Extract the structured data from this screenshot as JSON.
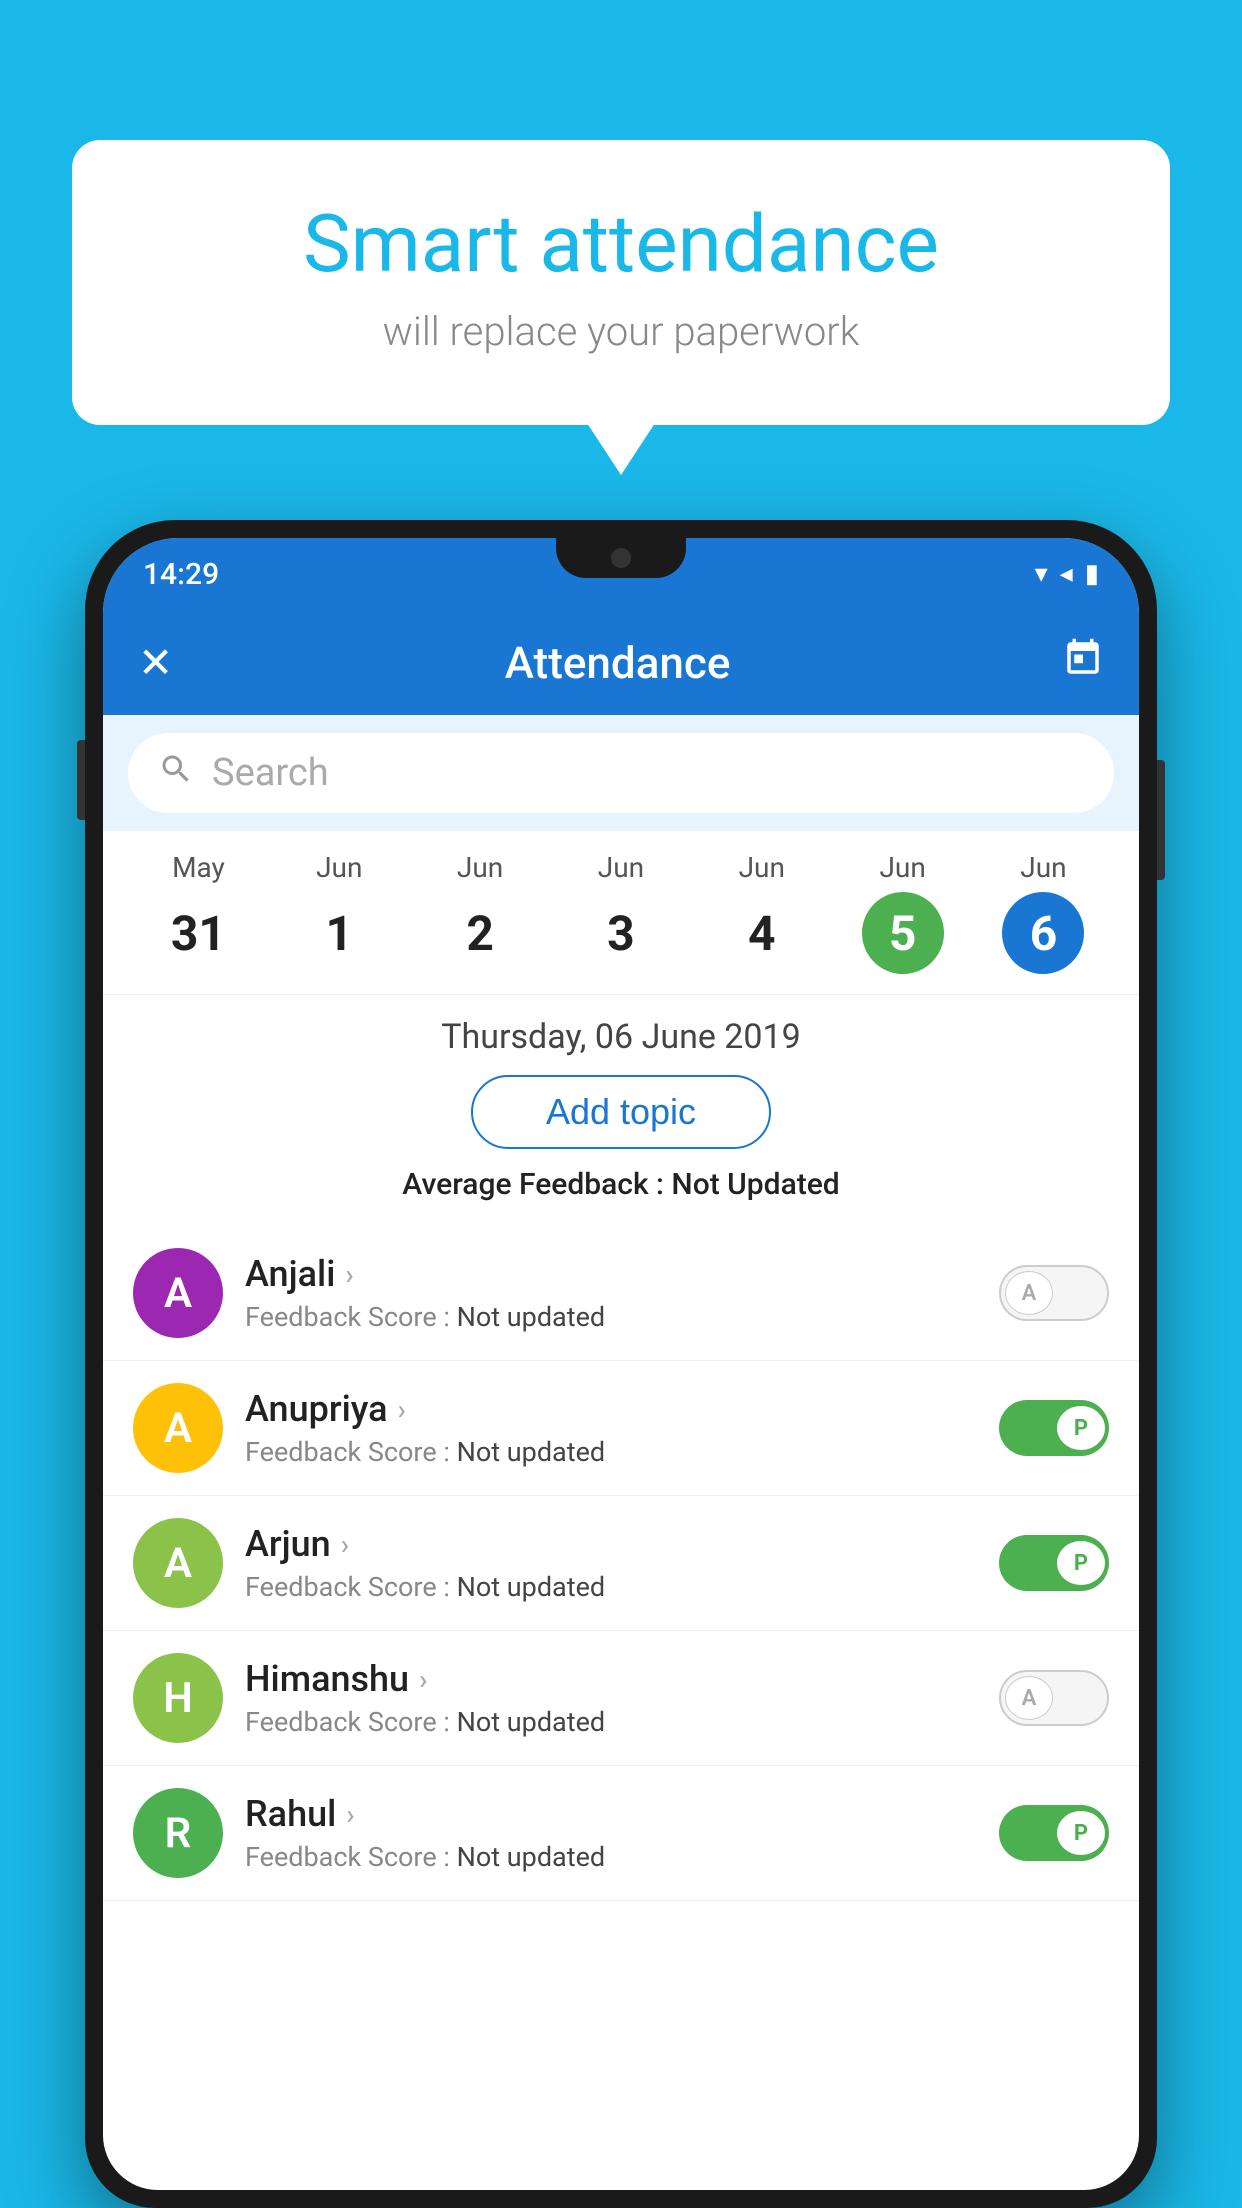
{
  "background": {
    "color": "#1ab8e8"
  },
  "bubble": {
    "title": "Smart attendance",
    "subtitle": "will replace your paperwork"
  },
  "status_bar": {
    "time": "14:29",
    "wifi_icon": "▼",
    "signal_icon": "◀",
    "battery_icon": "▮"
  },
  "app_bar": {
    "close_label": "✕",
    "title": "Attendance",
    "calendar_icon": "📅"
  },
  "search": {
    "placeholder": "Search"
  },
  "calendar": {
    "days": [
      {
        "month": "May",
        "date": "31",
        "state": "normal"
      },
      {
        "month": "Jun",
        "date": "1",
        "state": "normal"
      },
      {
        "month": "Jun",
        "date": "2",
        "state": "normal"
      },
      {
        "month": "Jun",
        "date": "3",
        "state": "normal"
      },
      {
        "month": "Jun",
        "date": "4",
        "state": "normal"
      },
      {
        "month": "Jun",
        "date": "5",
        "state": "today"
      },
      {
        "month": "Jun",
        "date": "6",
        "state": "selected"
      }
    ]
  },
  "selected_date": {
    "text": "Thursday, 06 June 2019"
  },
  "add_topic": {
    "label": "Add topic"
  },
  "average_feedback": {
    "label": "Average Feedback : ",
    "value": "Not Updated"
  },
  "students": [
    {
      "name": "Anjali",
      "avatar_letter": "A",
      "avatar_color": "#9c27b0",
      "feedback": "Feedback Score : ",
      "feedback_value": "Not updated",
      "attendance": "absent"
    },
    {
      "name": "Anupriya",
      "avatar_letter": "A",
      "avatar_color": "#ffc107",
      "feedback": "Feedback Score : ",
      "feedback_value": "Not updated",
      "attendance": "present"
    },
    {
      "name": "Arjun",
      "avatar_letter": "A",
      "avatar_color": "#8bc34a",
      "feedback": "Feedback Score : ",
      "feedback_value": "Not updated",
      "attendance": "present"
    },
    {
      "name": "Himanshu",
      "avatar_letter": "H",
      "avatar_color": "#8bc34a",
      "feedback": "Feedback Score : ",
      "feedback_value": "Not updated",
      "attendance": "absent"
    },
    {
      "name": "Rahul",
      "avatar_letter": "R",
      "avatar_color": "#4caf50",
      "feedback": "Feedback Score : ",
      "feedback_value": "Not updated",
      "attendance": "present"
    }
  ]
}
